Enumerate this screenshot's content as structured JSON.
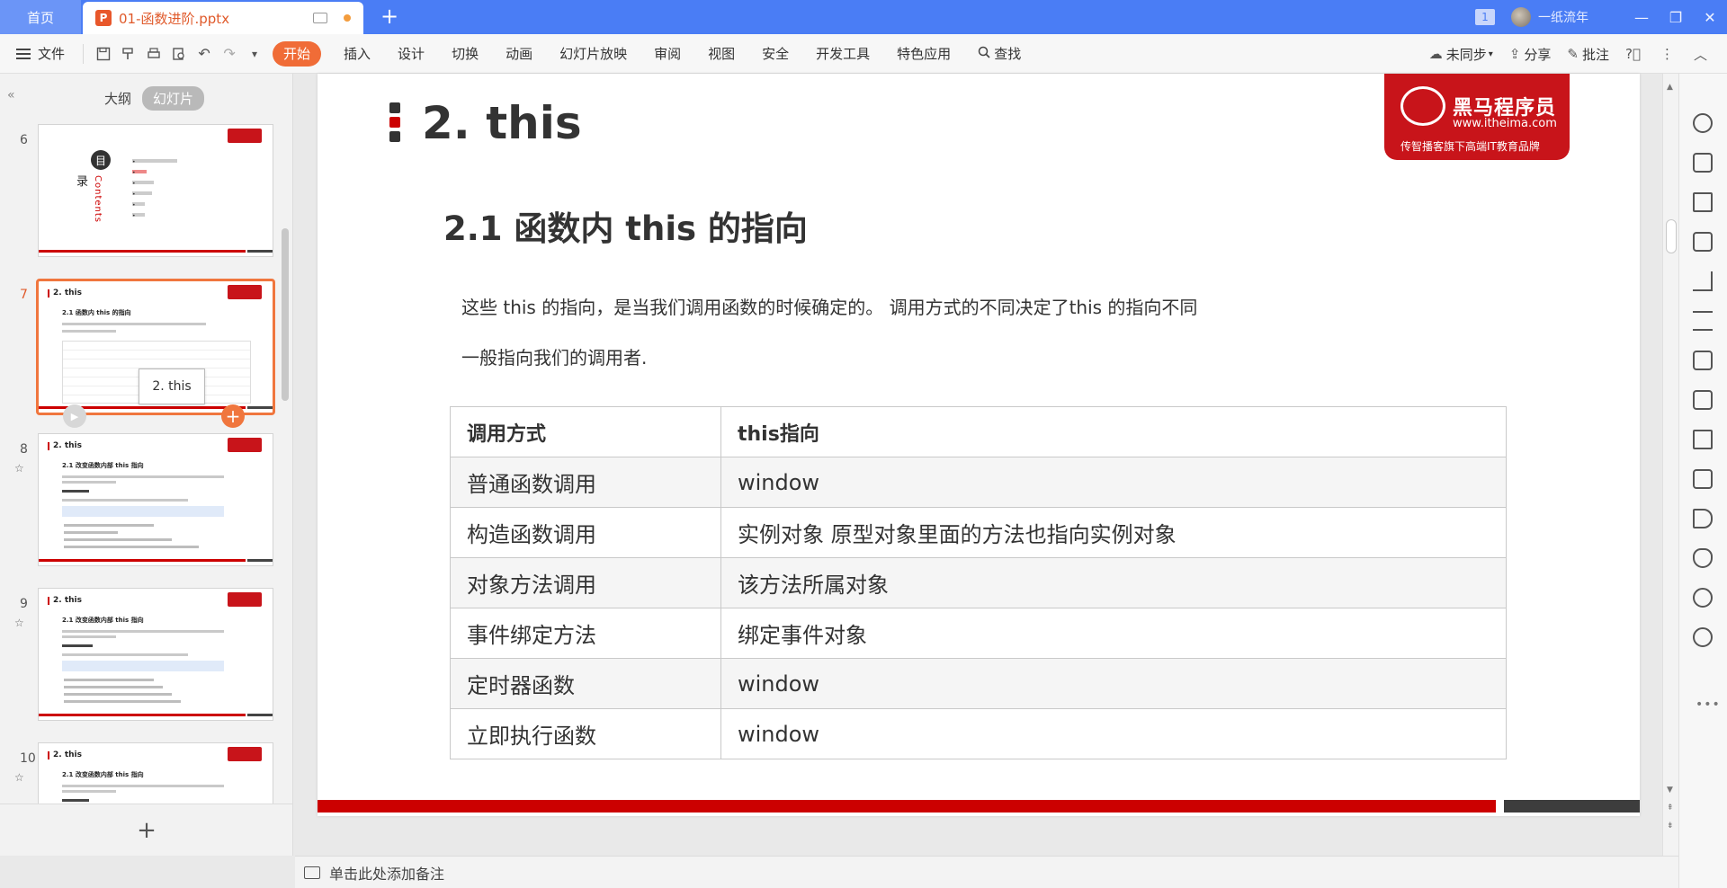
{
  "tabbar": {
    "home": "首页",
    "doc_title": "01-函数进阶.pptx",
    "doc_icon": "P",
    "add": "+",
    "badge": "1",
    "user": "一纸流年",
    "minimize": "—",
    "restore": "❐",
    "close": "✕"
  },
  "ribbon": {
    "menu_label": "文件",
    "tabs": [
      "开始",
      "插入",
      "设计",
      "切换",
      "动画",
      "幻灯片放映",
      "审阅",
      "视图",
      "安全",
      "开发工具",
      "特色应用"
    ],
    "search": "查找",
    "sync": "未同步",
    "share": "分享",
    "comment": "批注"
  },
  "left": {
    "tab_outline": "大纲",
    "tab_slides": "幻灯片",
    "tooltip": "2. this",
    "add": "+",
    "slide_numbers": [
      "6",
      "7",
      "8",
      "9",
      "10"
    ],
    "star": "☆",
    "toc": {
      "mu": "目",
      "lu": "录",
      "contents": "Contents"
    },
    "thumb_titles": {
      "t7": "2. this",
      "t8": "2. this",
      "t9": "2. this",
      "t10": "2. this"
    },
    "thumb_subs": {
      "t7": "2.1 函数内 this 的指向",
      "t8": "2.1 改变函数内部 this 指向",
      "t9": "2.1 改变函数内部 this 指向",
      "t10": "2.1 改变函数内部 this 指向"
    }
  },
  "slide": {
    "title": "2. this",
    "logo_brand": "黑马程序员",
    "logo_url": "www.itheima.com",
    "logo_slogan": "传智播客旗下高端IT教育品牌",
    "heading": "2.1 函数内 this 的指向",
    "para1": "这些 this 的指向，是当我们调用函数的时候确定的。 调用方式的不同决定了this 的指向不同",
    "para2": "一般指向我们的调用者.",
    "table": {
      "headers": [
        "调用方式",
        "this指向"
      ],
      "rows": [
        [
          "普通函数调用",
          "window"
        ],
        [
          "构造函数调用",
          "实例对象  原型对象里面的方法也指向实例对象"
        ],
        [
          "对象方法调用",
          "该方法所属对象"
        ],
        [
          "事件绑定方法",
          "绑定事件对象"
        ],
        [
          "定时器函数",
          "window"
        ],
        [
          "立即执行函数",
          "window"
        ]
      ]
    }
  },
  "notes": {
    "placeholder": "单击此处添加备注"
  },
  "colors": {
    "tabbar": "#4a7df5",
    "accent": "#f06c37",
    "brand_red": "#c8141a"
  }
}
